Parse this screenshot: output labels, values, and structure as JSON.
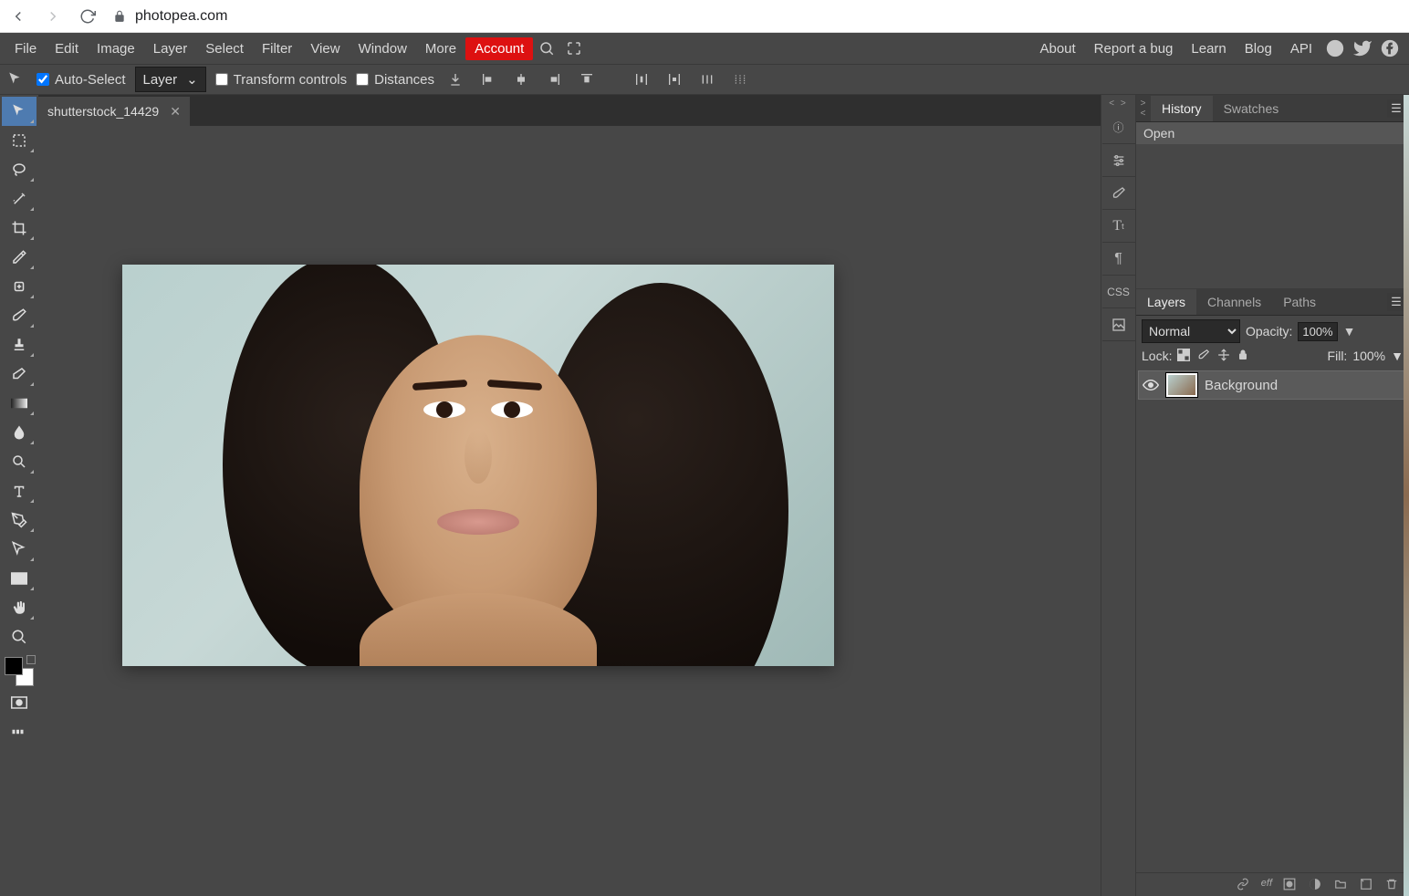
{
  "browser": {
    "url": "photopea.com"
  },
  "menu": {
    "items": [
      "File",
      "Edit",
      "Image",
      "Layer",
      "Select",
      "Filter",
      "View",
      "Window",
      "More"
    ],
    "account": "Account",
    "right": [
      "About",
      "Report a bug",
      "Learn",
      "Blog",
      "API"
    ]
  },
  "options": {
    "auto_select": "Auto-Select",
    "auto_select_checked": true,
    "target": "Layer",
    "transform": "Transform controls",
    "transform_checked": false,
    "distances": "Distances",
    "distances_checked": false
  },
  "tab": {
    "name": "shutterstock_14429"
  },
  "midcol_css": "CSS",
  "history": {
    "tabs": [
      "History",
      "Swatches"
    ],
    "active": 0,
    "rows": [
      "Open"
    ]
  },
  "layers": {
    "tabs": [
      "Layers",
      "Channels",
      "Paths"
    ],
    "active": 0,
    "blend": "Normal",
    "opacity_label": "Opacity:",
    "opacity": "100%",
    "lock_label": "Lock:",
    "fill_label": "Fill:",
    "fill": "100%",
    "layer_name": "Background"
  },
  "layer_bottom_label": "eff"
}
